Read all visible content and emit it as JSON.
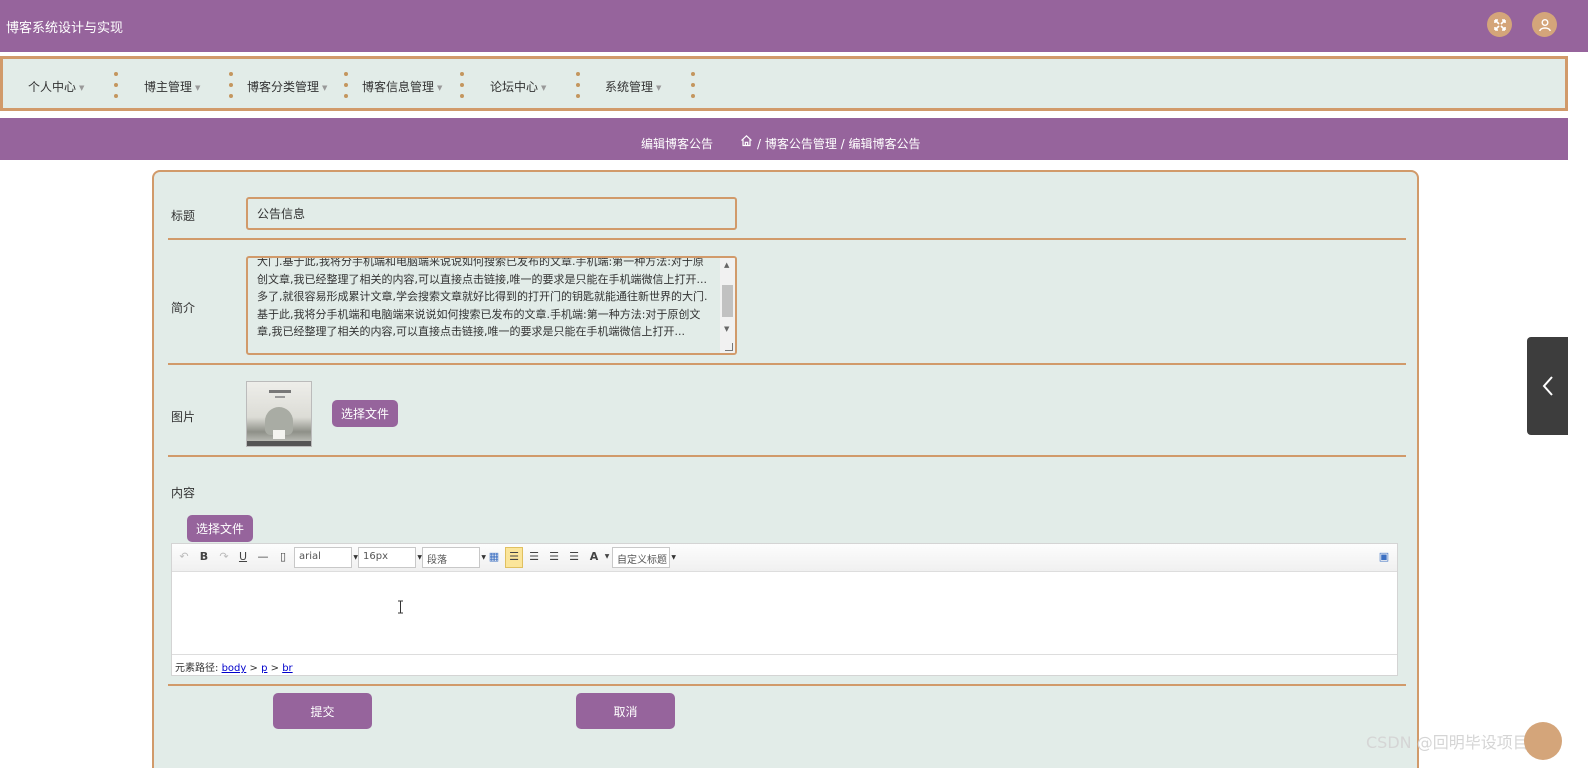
{
  "app": {
    "title": "博客系统设计与实现"
  },
  "topbar": {
    "fullscreen_icon": "expand-icon",
    "user_icon": "user-icon"
  },
  "nav": {
    "items": [
      {
        "label": "个人中心"
      },
      {
        "label": "博主管理"
      },
      {
        "label": "博客分类管理"
      },
      {
        "label": "博客信息管理"
      },
      {
        "label": "论坛中心"
      },
      {
        "label": "系统管理"
      }
    ]
  },
  "breadcrumb": {
    "title": "编辑博客公告",
    "path": "/ 博客公告管理 / 编辑博客公告"
  },
  "form": {
    "title_label": "标题",
    "title_value": "公告信息",
    "intro_label": "简介",
    "intro_text": "大门.基于此,我将分手机端和电脑端来说说如何搜索已发布的文章.手机端:第一种方法:对于原创文章,我已经整理了相关的内容,可以直接点击链接,唯一的要求是只能在手机端微信上打开...多了,就很容易形成累计文章,学会搜索文章就好比得到的打开门的钥匙就能通往新世界的大门.基于此,我将分手机端和电脑端来说说如何搜索已发布的文章.手机端:第一种方法:对于原创文章,我已经整理了相关的内容,可以直接点击链接,唯一的要求是只能在手机端微信上打开...",
    "image_label": "图片",
    "image_button": "选择文件",
    "content_label": "内容",
    "content_button": "选择文件",
    "submit_label": "提交",
    "cancel_label": "取消"
  },
  "editor": {
    "font_family": "arial",
    "font_size": "16px",
    "paragraph": "段落",
    "custom_title": "自定义标题",
    "status_prefix": "元素路径:",
    "path_body": "body",
    "path_p": "p",
    "path_br": "br",
    "path_sep": ">"
  },
  "watermark": "CSDN @回明毕设项目"
}
